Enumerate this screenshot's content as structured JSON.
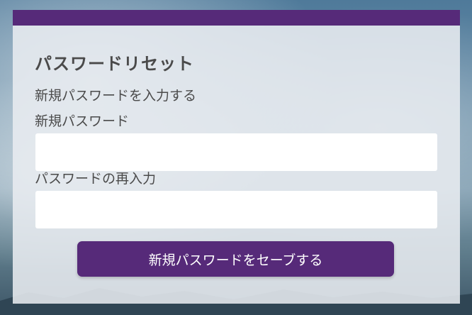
{
  "card": {
    "title": "パスワードリセット",
    "instruction": "新規パスワードを入力する"
  },
  "fields": {
    "new_password": {
      "label": "新規パスワード",
      "value": "",
      "placeholder": ""
    },
    "confirm_password": {
      "label": "パスワードの再入力",
      "value": "",
      "placeholder": ""
    }
  },
  "actions": {
    "save_label": "新規パスワードをセーブする"
  },
  "colors": {
    "accent": "#562a79",
    "card_background": "#e8ecf0",
    "text": "#4a4a4a"
  }
}
